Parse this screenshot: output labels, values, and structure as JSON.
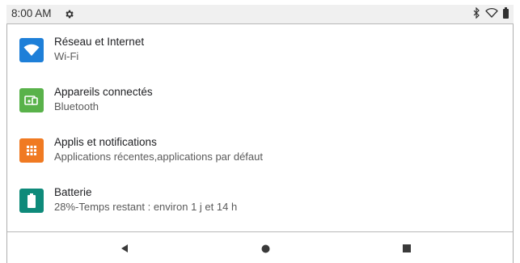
{
  "status_bar": {
    "time": "8:00 AM",
    "left_icon": "gear-icon",
    "right_icons": [
      "bluetooth-icon",
      "wifi-outline-icon",
      "battery-icon"
    ]
  },
  "settings": [
    {
      "title": "Réseau et Internet",
      "subtitle": "Wi-Fi",
      "icon": "wifi-icon",
      "color": "#1e7fd8"
    },
    {
      "title": "Appareils connectés",
      "subtitle": "Bluetooth",
      "icon": "connected-devices-icon",
      "color": "#59b24a"
    },
    {
      "title": "Applis et notifications",
      "subtitle": "Applications récentes,applications par défaut",
      "icon": "apps-grid-icon",
      "color": "#f07a22"
    },
    {
      "title": "Batterie",
      "subtitle": "28%-Temps restant : environ 1 j et 14 h",
      "icon": "battery-icon",
      "color": "#0e8a7a"
    }
  ],
  "nav_bar": {
    "icons": [
      "back-icon",
      "home-icon",
      "recents-icon"
    ]
  }
}
